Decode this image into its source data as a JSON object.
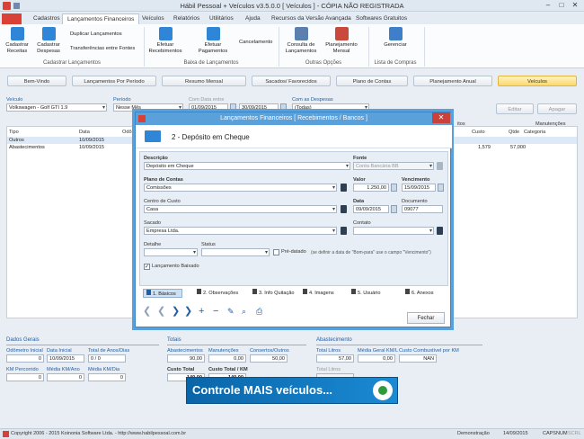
{
  "window": {
    "title": "Hábil Pessoal + Veículos v3.5.0.0 [ Veículos ] - CÓPIA NÃO REGISTRADA"
  },
  "menu": [
    "Cadastros",
    "Lançamentos Financeiros",
    "Veículos",
    "Relatórios",
    "Utilitários",
    "Ajuda",
    "Recursos da Versão Avançada",
    "Softwares Gratuitos"
  ],
  "ribbon": {
    "cadastrar_receitas": "Cadastrar Receitas",
    "cadastrar_despesas": "Cadastrar Despesas",
    "duplicar": "Duplicar Lançamentos",
    "transferencias": "Transferências entre Fontes",
    "group_cadastro": "Cadastrar Lançamentos",
    "efetuar_recebimentos": "Efetuar Recebimentos",
    "efetuar_pagamentos": "Efetuar Pagamentos",
    "cancelamento": "Cancelamento",
    "group_baixa": "Baixa de Lançamentos",
    "consulta": "Consulta de Lançamentos",
    "planejamento": "Planejamento Mensal",
    "group_outras": "Outras Opções",
    "gerenciar": "Gerenciar",
    "group_compras": "Lista de Compras"
  },
  "tabs": [
    "Bem-Vindo",
    "Lançamentos Por Período",
    "Resumo Mensal",
    "Sacados/ Favorecidos",
    "Plano de Contas",
    "Planejamento Anual",
    "Veículos"
  ],
  "filters": {
    "veiculo_label": "Veículo",
    "veiculo_value": "Volkswagen - Golf GTI 1.9",
    "periodo_label": "Período",
    "periodo_value": "Nesse Mês",
    "data_label": "Com Data entre",
    "data_de": "01/09/2015",
    "data_ate": "30/09/2015",
    "despesas_label": "Com as Despesas",
    "despesas_value": "(Todas)",
    "editar": "Editar",
    "apagar": "Apagar"
  },
  "grid": {
    "headers": [
      "Tipo",
      "Data",
      "Odôm"
    ],
    "right_headers": {
      "custo": "Custo",
      "qtde": "Qtde",
      "manut": "Manutenções",
      "categoria": "Categoria",
      "itos": "itos"
    },
    "rows": [
      {
        "tipo": "Outros",
        "data": "10/09/2015",
        "custo": "",
        "qtde": ""
      },
      {
        "tipo": "Abastecimentos",
        "data": "10/09/2015",
        "custo": "1,579",
        "qtde": "57,000"
      }
    ]
  },
  "dados_gerais": {
    "title": "Dados Gerais",
    "odometro_label": "Odômetro Inicial",
    "odometro": "0",
    "data_inicial_label": "Data Inicial",
    "data_inicial": "10/09/2015",
    "total_anos_label": "Total de Anos/Dias",
    "total_anos": "0 / 0",
    "km_percorrido_label": "KM Percorrido",
    "km_percorrido": "0",
    "media_km_ano_label": "Média KM/Ano",
    "media_km_ano": "0",
    "media_km_dia_label": "Média KM/Dia",
    "media_km_dia": "0"
  },
  "totais": {
    "title": "Totais",
    "abastecimentos_label": "Abastecimentos",
    "abastecimentos": "90,00",
    "manutencoes_label": "Manutenções",
    "manutencoes": "0,00",
    "consertos_label": "Consertos/Outros",
    "consertos": "50,00",
    "custo_total_label": "Custo Total",
    "custo_total": "140,00",
    "custo_km_label": "Custo Total / KM",
    "custo_km": "140,00"
  },
  "abastecimento": {
    "title": "Abastecimento",
    "total_litros_label": "Total Litros",
    "total_litros": "57,00",
    "media_geral_label": "Média Geral KM/L",
    "media_geral": "0,00",
    "custo_comb_label": "Custo Combustível por KM",
    "custo_comb": "NAN",
    "total_litros2_label": "Total Litros"
  },
  "banner": {
    "text": "Controle MAIS veículos..."
  },
  "footer": {
    "copyright": "Copyright 2006 - 2015 Koinonia Software Ltda. - http://www.habilpessoal.com.br",
    "mode": "Demonstração",
    "date": "14/09/2015",
    "caps": "CAPS",
    "num": "NUM",
    "scrl": "SCRL"
  },
  "dialog": {
    "title": "Lançamentos Financeiros [ Recebimentos / Bancos ]",
    "header": "2 - Depósito em Cheque",
    "descricao_label": "Descrição",
    "descricao": "Depósito em Cheque",
    "fonte_label": "Fonte",
    "fonte": "Conta Bancária BB",
    "plano_label": "Plano de Contas",
    "plano": "Comissões",
    "valor_label": "Valor",
    "valor": "1.250,00",
    "vencimento_label": "Vencimento",
    "vencimento": "15/09/2015",
    "centro_label": "Centro de Custo",
    "centro": "Casa",
    "data_label": "Data",
    "data": "09/09/2015",
    "documento_label": "Documento",
    "documento": "09077",
    "sacado_label": "Sacado",
    "sacado": "Empresa Ltda.",
    "contato_label": "Contato",
    "contato": "",
    "detalhe_label": "Detalhe",
    "status_label": "Status",
    "pre_datado": "Pré-datado",
    "pre_datado_hint": "(se definir a data de \"Bom-para\" use o campo \"Vencimento\")",
    "baixado": "Lançamento Baixado",
    "subtabs": [
      "1. Básicos",
      "2. Observações",
      "3. Info Quitação",
      "4. Imagens",
      "5. Usuário",
      "6. Anexos"
    ],
    "fechar": "Fechar"
  }
}
